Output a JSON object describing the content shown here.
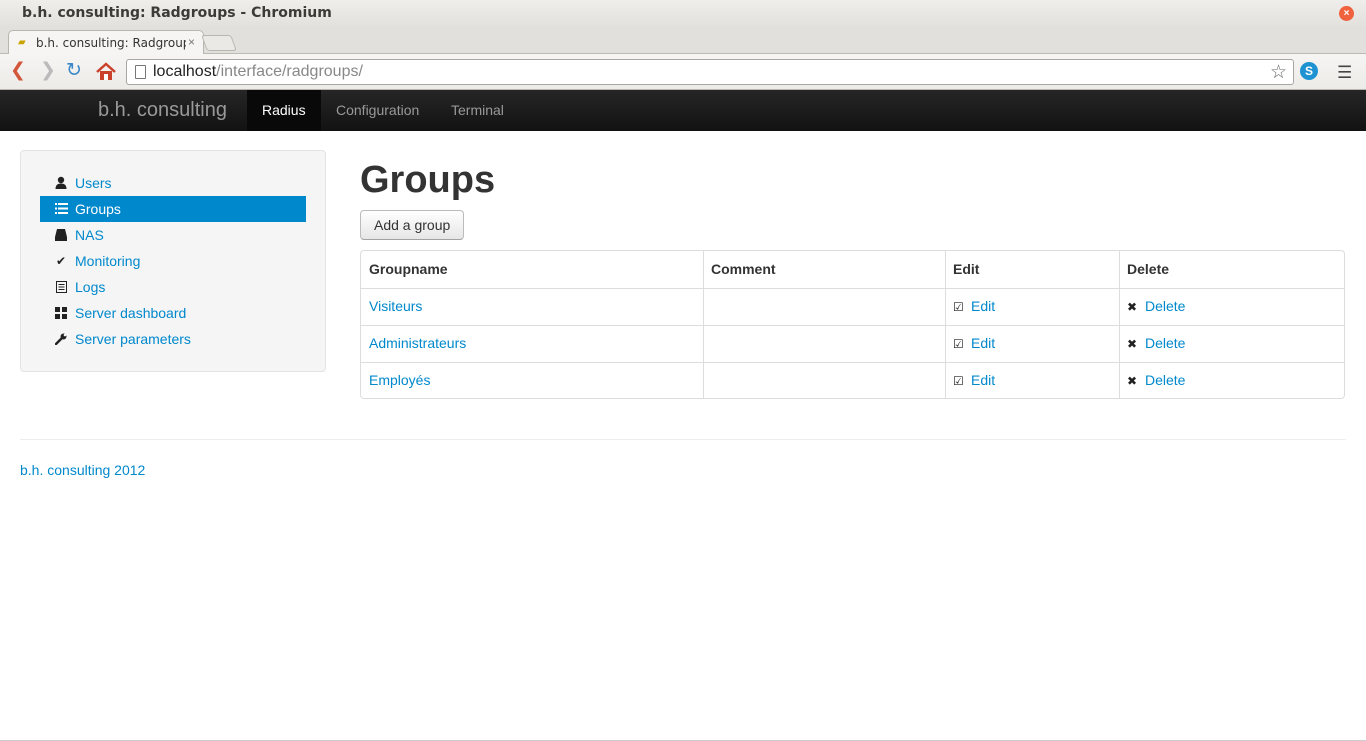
{
  "window": {
    "title": "b.h. consulting: Radgroups - Chromium",
    "close_icon": "close-icon"
  },
  "tab": {
    "label": "b.h. consulting: Radgroups",
    "close": "×"
  },
  "addressbar": {
    "host": "localhost",
    "path": "/interface/radgroups/"
  },
  "navbar": {
    "brand": "b.h. consulting",
    "items": [
      {
        "label": "Radius",
        "active": true
      },
      {
        "label": "Configuration",
        "active": false
      },
      {
        "label": "Terminal",
        "active": false
      }
    ]
  },
  "sidebar": {
    "items": [
      {
        "label": "Users",
        "icon": "user-icon",
        "active": false
      },
      {
        "label": "Groups",
        "icon": "list-icon",
        "active": true
      },
      {
        "label": "NAS",
        "icon": "hdd-icon",
        "active": false
      },
      {
        "label": "Monitoring",
        "icon": "check-icon",
        "active": false
      },
      {
        "label": "Logs",
        "icon": "list-alt-icon",
        "active": false
      },
      {
        "label": "Server dashboard",
        "icon": "th-large-icon",
        "active": false
      },
      {
        "label": "Server parameters",
        "icon": "wrench-icon",
        "active": false
      }
    ]
  },
  "main": {
    "title": "Groups",
    "add_button": "Add a group",
    "table": {
      "headers": [
        "Groupname",
        "Comment",
        "Edit",
        "Delete"
      ],
      "rows": [
        {
          "groupname": "Visiteurs",
          "comment": "",
          "edit": "Edit",
          "delete": "Delete"
        },
        {
          "groupname": "Administrateurs",
          "comment": "",
          "edit": "Edit",
          "delete": "Delete"
        },
        {
          "groupname": "Employés",
          "comment": "",
          "edit": "Edit",
          "delete": "Delete"
        }
      ]
    }
  },
  "footer": {
    "text": "b.h. consulting 2012"
  },
  "colors": {
    "link": "#0088cc",
    "navbar": "#1b1b1b",
    "active_side": "#0088cc"
  }
}
